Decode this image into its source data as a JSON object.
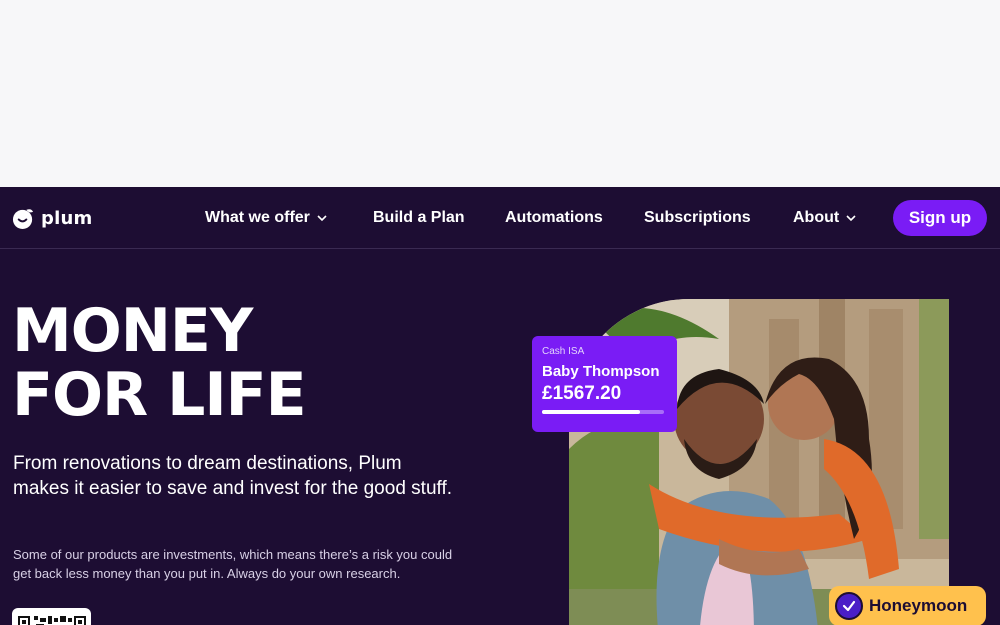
{
  "brand": {
    "name": "plum"
  },
  "nav": {
    "items": [
      {
        "label": "What we offer",
        "has_dropdown": true
      },
      {
        "label": "Build a Plan",
        "has_dropdown": false
      },
      {
        "label": "Automations",
        "has_dropdown": false
      },
      {
        "label": "Subscriptions",
        "has_dropdown": false
      },
      {
        "label": "About",
        "has_dropdown": true
      }
    ],
    "signup_label": "Sign up"
  },
  "hero": {
    "headline_line1": "MONEY",
    "headline_line2": "FOR LIFE",
    "subheading": "From renovations to dream destinations, Plum makes it easier to save and invest for the good stuff.",
    "disclaimer": "Some of our products are investments, which means there’s a risk you could get back less money than you put in. Always do your own research."
  },
  "savings_card": {
    "type": "Cash ISA",
    "name": "Baby Thompson",
    "amount": "£1567.20",
    "progress": 0.8
  },
  "goal_pill": {
    "label": "Honeymoon",
    "icon": "check-icon"
  },
  "colors": {
    "background": "#1d0d33",
    "accent": "#7a1cf5",
    "pill": "#ffc14d"
  }
}
